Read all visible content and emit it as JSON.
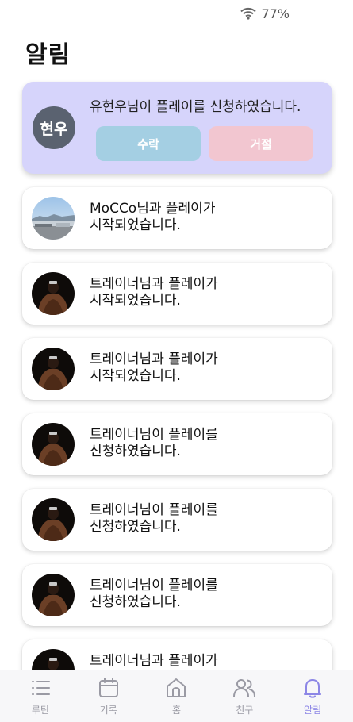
{
  "status_bar": {
    "battery": "77%",
    "wifi_icon": "wifi-icon"
  },
  "page_title": "알림",
  "request": {
    "avatar_text": "현우",
    "message": "유현우님이 플레이를 신청하였습니다.",
    "accept_label": "수락",
    "reject_label": "거절",
    "colors": {
      "card_bg": "#d6d4fb",
      "accept_bg": "#a4cfe3",
      "reject_bg": "#f2c6d0"
    }
  },
  "notifications": [
    {
      "line1": "MoCCo님과 플레이가",
      "line2": "시작되었습니다.",
      "avatar": "landscape-photo"
    },
    {
      "line1": "트레이너님과 플레이가",
      "line2": "시작되었습니다.",
      "avatar": "trainer-photo"
    },
    {
      "line1": "트레이너님과 플레이가",
      "line2": "시작되었습니다.",
      "avatar": "trainer-photo"
    },
    {
      "line1": "트레이너님이 플레이를",
      "line2": "신청하였습니다.",
      "avatar": "trainer-photo"
    },
    {
      "line1": "트레이너님이 플레이를",
      "line2": "신청하였습니다.",
      "avatar": "trainer-photo"
    },
    {
      "line1": "트레이너님이 플레이를",
      "line2": "신청하였습니다.",
      "avatar": "trainer-photo"
    },
    {
      "line1": "트레이너님과 플레이가",
      "line2": "",
      "avatar": "trainer-photo"
    }
  ],
  "nav": {
    "routine": {
      "label": "루틴",
      "icon": "list-icon"
    },
    "record": {
      "label": "기록",
      "icon": "calendar-icon"
    },
    "home": {
      "label": "홈",
      "icon": "home-icon"
    },
    "friends": {
      "label": "친구",
      "icon": "friends-icon"
    },
    "alarm": {
      "label": "알림",
      "icon": "bell-icon",
      "active": true
    },
    "active_color": "#8c86e6"
  }
}
